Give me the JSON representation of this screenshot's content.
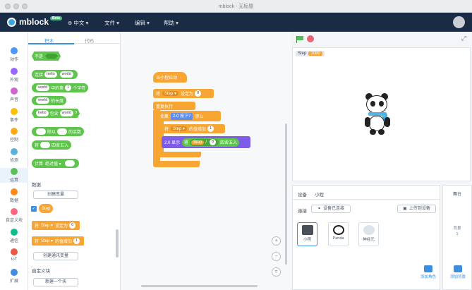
{
  "window": {
    "title": "mblock - 无标题"
  },
  "menubar": {
    "logo": "mblock",
    "badge": "Beta",
    "language": "⊕ 中文 ▾",
    "file": "文件 ▾",
    "edit": "编辑 ▾",
    "help": "帮助 ▾"
  },
  "palette": {
    "tabs": [
      "积木",
      "代码"
    ],
    "categories": [
      {
        "label": "动作",
        "color": "#4c97ff"
      },
      {
        "label": "外观",
        "color": "#9966ff"
      },
      {
        "label": "声音",
        "color": "#cf63cf"
      },
      {
        "label": "事件",
        "color": "#ffbf00"
      },
      {
        "label": "控制",
        "color": "#ffab19"
      },
      {
        "label": "侦测",
        "color": "#5cb1d6"
      },
      {
        "label": "运算",
        "color": "#59c059"
      },
      {
        "label": "数据",
        "color": "#ff8c1a"
      },
      {
        "label": "自定义块",
        "color": "#ff6680"
      },
      {
        "label": "通信",
        "color": "#0fbd8c"
      },
      {
        "label": "IoT",
        "color": "#e95a46"
      },
      {
        "label": "扩展",
        "color": "#3d8de0"
      }
    ],
    "blocks": {
      "not": "不是",
      "join_prefix": "连接",
      "join_a": "hello",
      "join_b": "world",
      "letter_a": "world",
      "letter_mid": "中的第",
      "letter_n": "1",
      "letter_suffix": "个字符",
      "length_a": "world",
      "length_suffix": "的长度",
      "contains_a": "hello",
      "contains_mid": "包含",
      "contains_b": "world",
      "contains_suffix": "?",
      "mod_mid": "除以",
      "mod_suffix": "的余数",
      "round_prefix": "将",
      "round_suffix": "四舍五入",
      "math_prefix": "计算",
      "math_fn": "绝对值 ▾"
    },
    "data_section": "数据",
    "create_var": "创建变量",
    "var_name": "Step",
    "set_prefix": "将",
    "set_var": "Step ▾",
    "set_mid": "设定为",
    "set_val": "0",
    "change_prefix": "将",
    "change_var": "Step ▾",
    "change_mid": "的值增加",
    "change_val": "1",
    "create_list": "创建通讯变量",
    "custom_section": "自定义块",
    "make_block": "新建一个块"
  },
  "workspace": {
    "hat": "当小程启动",
    "set": {
      "prefix": "将",
      "var": "Step ▾",
      "mid": "设定为",
      "val": "0"
    },
    "forever": "重复执行",
    "if_prefix": "如果",
    "if_cond": "2.0 按下?",
    "if_suffix": "那么",
    "change": {
      "prefix": "将",
      "var": "Step ▾",
      "mid": "的值增加",
      "val": "1"
    },
    "show": {
      "prefix": "2.0 显示",
      "round_prefix": "将",
      "var": "Step",
      "op": "/",
      "val": "8",
      "round_suffix": "四舍五入"
    },
    "zoom": [
      "+",
      "−",
      "="
    ]
  },
  "stage": {
    "var_label": "Step",
    "var_value": "1080"
  },
  "sprites": {
    "devices_tab": "设备",
    "sprites_tab": "小程",
    "connect": "连接",
    "connect_btn": "设备已连接",
    "upload_btn": "上传到设备",
    "items": [
      {
        "label": "小程"
      },
      {
        "label": "Panda"
      },
      {
        "label": "神经元"
      }
    ],
    "add_sprite": "添加角色",
    "add_backdrop": "添加背景",
    "stage_title": "舞台",
    "backdrop_label": "背景",
    "backdrop_count": "1"
  },
  "colors": {
    "menubar": "#1a2b45",
    "operators": "#5fc44c",
    "variables": "#f7a533",
    "pen": "#7e5be8",
    "accent": "#3d8de0"
  }
}
